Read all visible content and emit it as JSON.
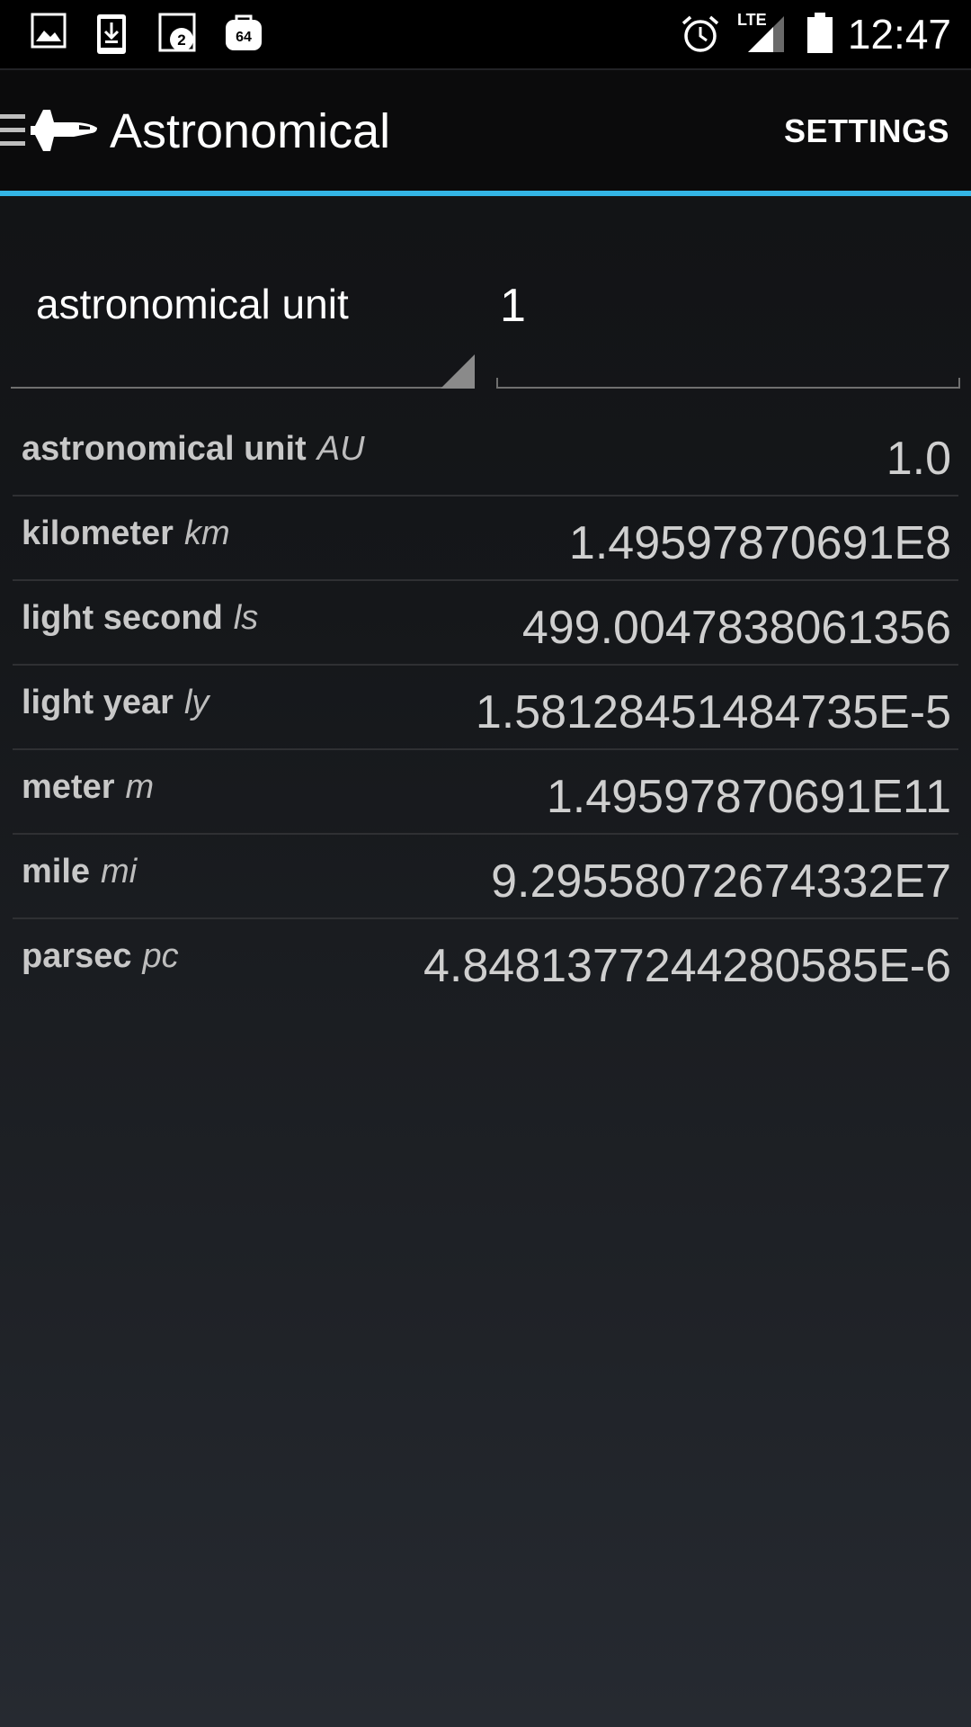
{
  "status_bar": {
    "time": "12:47",
    "notification_icons": [
      "image-icon",
      "download-icon",
      "badge-2-icon",
      "badge-64-icon"
    ],
    "badge_counts": [
      "2",
      "64"
    ],
    "network_label": "LTE",
    "system_icons": [
      "alarm-icon",
      "signal-icon",
      "battery-icon"
    ]
  },
  "action_bar": {
    "title": "Astronomical",
    "settings_label": "SETTINGS",
    "menu_icon": "hamburger-menu-icon",
    "app_icon": "space-shuttle-icon"
  },
  "colors": {
    "accent": "#33b5e5",
    "background_top": "#111214",
    "background_bottom": "#262a31"
  },
  "converter": {
    "selected_unit": "astronomical unit",
    "input_value": "1"
  },
  "results": [
    {
      "name": "astronomical unit",
      "symbol": "AU",
      "value": "1.0"
    },
    {
      "name": "kilometer",
      "symbol": "km",
      "value": "1.49597870691E8"
    },
    {
      "name": "light second",
      "symbol": "ls",
      "value": "499.0047838061356"
    },
    {
      "name": "light year",
      "symbol": "ly",
      "value": "1.581284514847​35E-5"
    },
    {
      "name": "meter",
      "symbol": "m",
      "value": "1.49597870691E11"
    },
    {
      "name": "mile",
      "symbol": "mi",
      "value": "9.29558072674332E7"
    },
    {
      "name": "parsec",
      "symbol": "pc",
      "value": "4.8481377244280585E-6"
    }
  ]
}
